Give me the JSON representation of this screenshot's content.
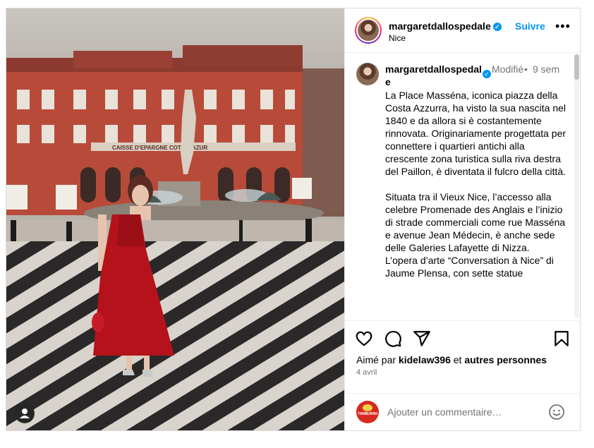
{
  "header": {
    "username": "margaretdallospedale",
    "follow_label": "Suivre",
    "location": "Nice",
    "more_icon": "more-horizontal-icon"
  },
  "photo": {
    "sign_text": "CAISSE D'EPARGNE COTE D'AZUR",
    "user_tag_icon": "user-tag-icon"
  },
  "caption": {
    "username": "margaretdallospedale",
    "edited": "Modifié",
    "time": "9 sem",
    "text": "La Place Masséna, iconica piazza della Costa Azzurra, ha visto la sua nascita nel 1840 e da allora si è costantemente rinnovata. Originariamente progettata per connettere i quartieri antichi alla crescente zona turistica sulla riva destra del Paillon, è diventata il fulcro della città.\n\nSituata tra il Vieux Nice, l’accesso alla celebre Promenade des Anglais e l’inizio di strade commerciali come rue Masséna e avenue Jean Médecin, è anche sede delle Galeries Lafayette di Nizza.\nL’opera d’arte “Conversation à Nice” di Jaume Plensa, con sette statue"
  },
  "actions": {
    "like_icon": "heart-icon",
    "comment_icon": "comment-icon",
    "share_icon": "share-icon",
    "save_icon": "bookmark-icon"
  },
  "likes": {
    "prefix": "Aimé par",
    "user": "kidelaw396",
    "joiner": "et",
    "others": "autres personnes"
  },
  "date": "4 avril",
  "comment": {
    "placeholder": "Ajouter un commentaire…",
    "emoji_icon": "emoji-icon"
  },
  "colors": {
    "accent": "#0095f6",
    "dress": "#b5121b",
    "building": "#b84a3a"
  }
}
